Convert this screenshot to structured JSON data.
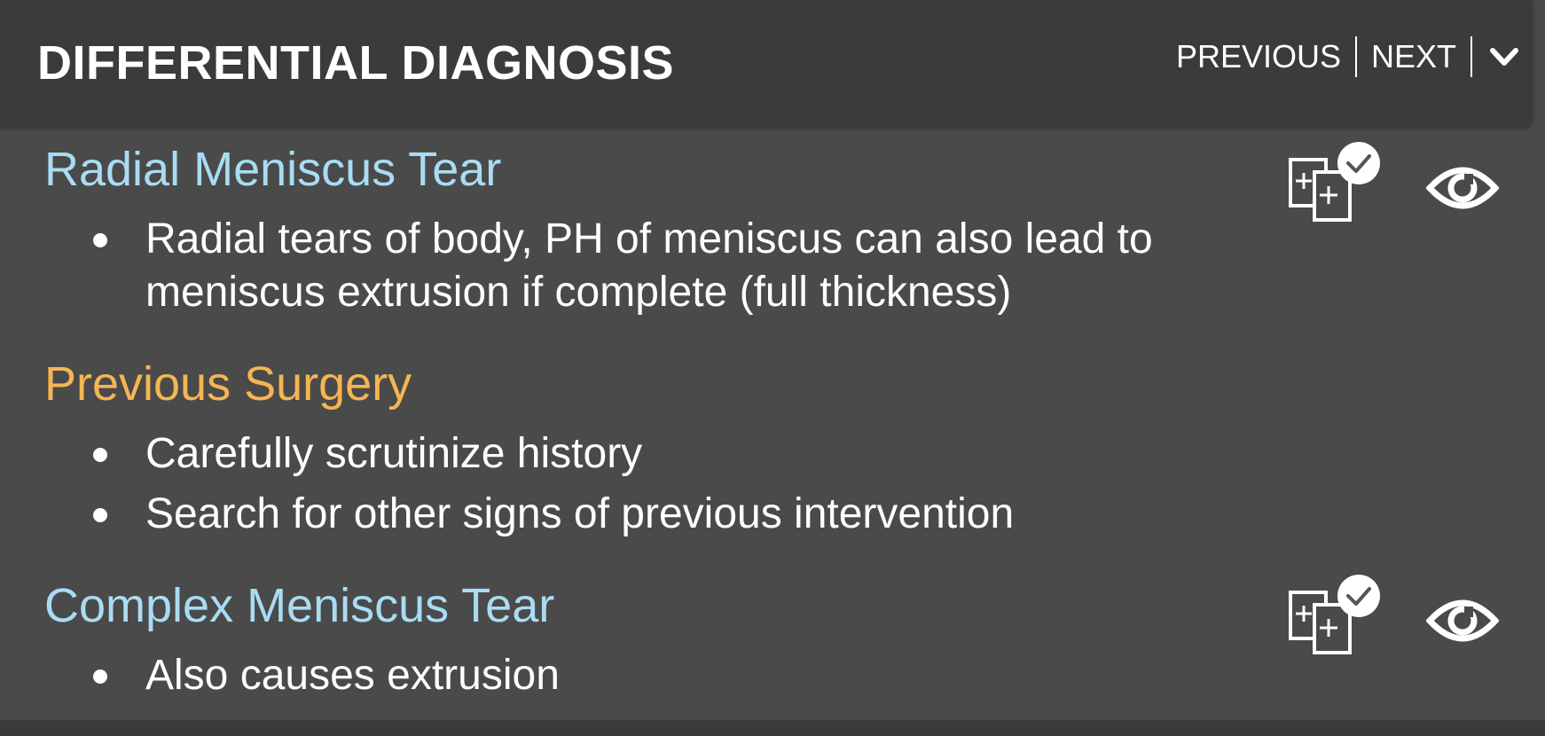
{
  "header": {
    "title": "DIFFERENTIAL DIAGNOSIS",
    "previous_label": "PREVIOUS",
    "next_label": "NEXT",
    "collapse_icon": "chevron-down-icon"
  },
  "colors": {
    "panel_bg": "#4a4a4a",
    "header_bg": "#3b3b3b",
    "blue_title": "#a9dcf2",
    "orange_title": "#f5b553",
    "text": "#ffffff"
  },
  "entries": [
    {
      "title": "Radial Meniscus Tear",
      "title_color": "#a9dcf2",
      "bullets": [
        "Radial tears of body, PH of meniscus can also lead to meniscus extrusion if complete (full thickness)"
      ],
      "has_actions": true
    },
    {
      "title": "Previous Surgery",
      "title_color": "#f5b553",
      "bullets": [
        "Carefully scrutinize history",
        "Search for other signs of previous intervention"
      ],
      "has_actions": false
    },
    {
      "title": "Complex Meniscus Tear",
      "title_color": "#a9dcf2",
      "bullets": [
        "Also causes extrusion"
      ],
      "has_actions": true
    }
  ],
  "icons": {
    "compare": "compare-cases-icon",
    "view": "eye-icon"
  }
}
